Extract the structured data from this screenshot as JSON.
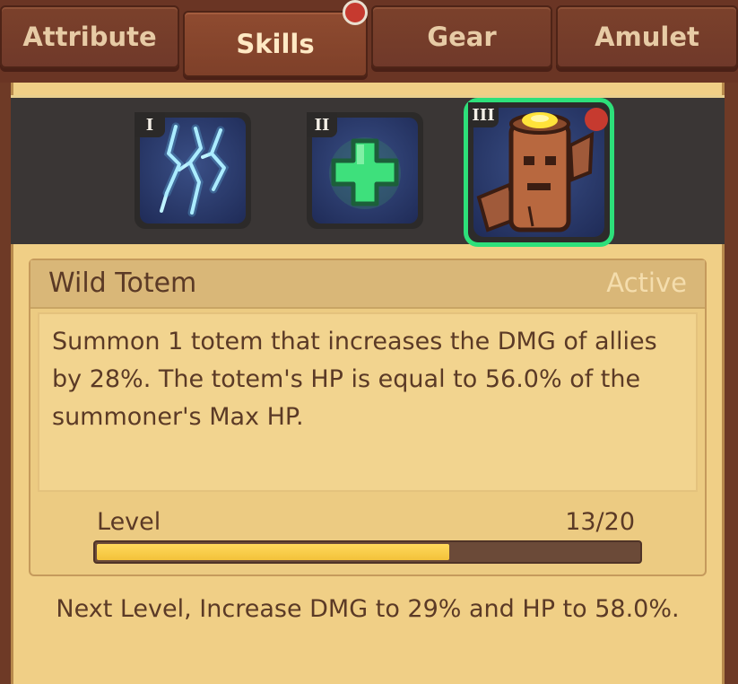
{
  "tabs": [
    {
      "label": "Attribute"
    },
    {
      "label": "Skills"
    },
    {
      "label": "Gear"
    },
    {
      "label": "Amulet"
    }
  ],
  "skills": [
    {
      "numeral": "I",
      "icon": "lightning-icon"
    },
    {
      "numeral": "II",
      "icon": "heal-cross-icon"
    },
    {
      "numeral": "III",
      "icon": "totem-icon"
    }
  ],
  "selected_skill": {
    "name": "Wild Totem",
    "status": "Active",
    "description": "Summon 1 totem that increases the DMG of allies by 28%. The totem's HP is equal to 56.0% of the summoner's Max HP.",
    "level_label": "Level",
    "level_value": "13/20",
    "level_progress": 0.65,
    "next_level": "Next Level, Increase DMG to 29% and HP to 58.0%."
  },
  "colors": {
    "accent_green": "#2de07a",
    "notification_red": "#c63a2f",
    "progress_yellow": "#f3c23a"
  }
}
